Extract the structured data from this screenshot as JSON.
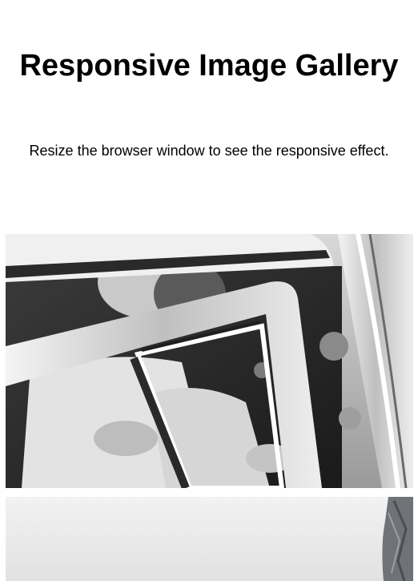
{
  "header": {
    "title": "Responsive Image Gallery",
    "subtitle": "Resize the browser window to see the responsive effect."
  },
  "gallery": {
    "images": [
      {
        "name": "wedding-couple-in-car-window"
      },
      {
        "name": "foggy-landscape-with-rock"
      }
    ]
  }
}
